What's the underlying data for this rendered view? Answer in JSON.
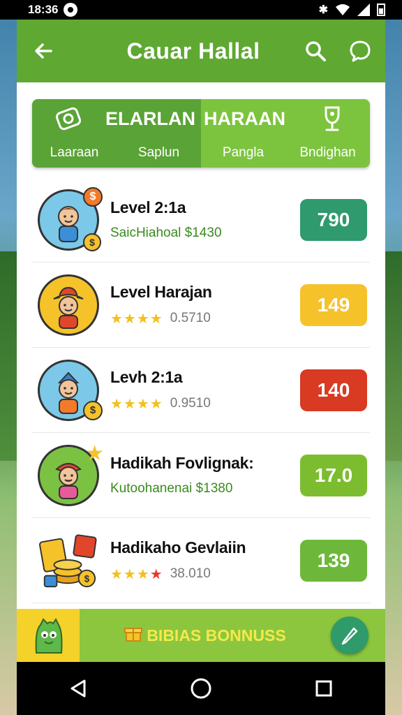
{
  "status_bar": {
    "time": "18:36"
  },
  "app_bar": {
    "title": "Cauar Hallal"
  },
  "tabs": {
    "left_title": "ELARLAN",
    "right_title": "HARAAN",
    "items": [
      {
        "label": "Laaraan",
        "icon": "gift-ticket-icon"
      },
      {
        "label": "Saplun"
      },
      {
        "label": "Pangla"
      },
      {
        "label": "Bndighan",
        "icon": "trophy-icon"
      }
    ]
  },
  "list": [
    {
      "title": "Level 2:1a",
      "subtitle": "SaicHiahoal $1430",
      "subtitle_style": "green",
      "score": "790",
      "score_color": "#2e9a6d",
      "avatar_bg": "#7cc8e8",
      "avatar": "boy-waving-avatar"
    },
    {
      "title": "Level Harajan",
      "stars": "★★★★",
      "rating": "0.5710",
      "score": "149",
      "score_color": "#f5c22a",
      "avatar_bg": "#f5c22a",
      "avatar": "cowboy-boy-avatar"
    },
    {
      "title": "Levh 2:1a",
      "stars": "★★★★",
      "rating": "0.9510",
      "score": "140",
      "score_color": "#d83a22",
      "avatar_bg": "#7cc8e8",
      "avatar": "boy-coins-avatar"
    },
    {
      "title": "Hadikah Fovlignak:",
      "subtitle": "Kutoohanenai $1380",
      "subtitle_style": "green",
      "score": "17.0",
      "score_color": "#7cbd2f",
      "avatar_bg": "#7cc242",
      "avatar": "girl-waving-avatar"
    },
    {
      "title": "Hadikaho Gevlaiin",
      "stars": "★★★",
      "stars_red": "★",
      "rating": "38.010",
      "score": "139",
      "score_color": "#6db83a",
      "avatar_bg": "#ffffff",
      "avatar": "coins-wallet-icon"
    }
  ],
  "bonus": {
    "label": "BIBIAS BONNUSS"
  },
  "colors": {
    "primary": "#5fa832",
    "accent": "#8cc63f",
    "fab": "#2f9a6a"
  }
}
